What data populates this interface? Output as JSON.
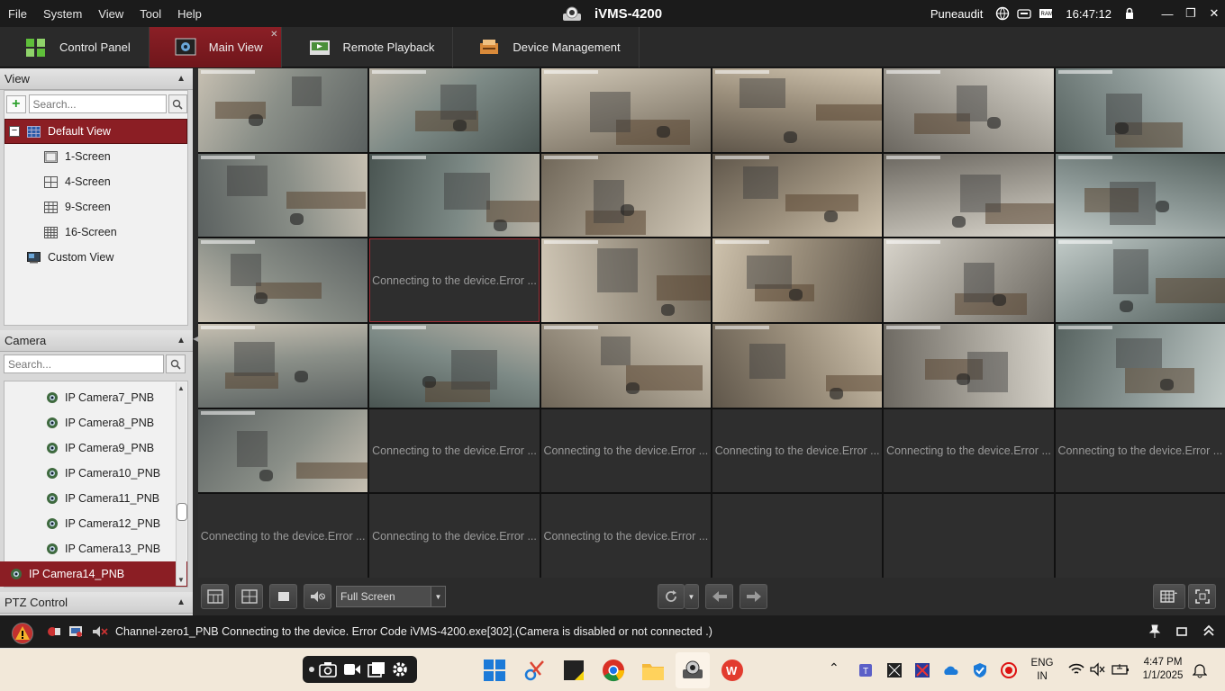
{
  "menubar": {
    "menus": [
      "File",
      "System",
      "View",
      "Tool",
      "Help"
    ],
    "app_title": "iVMS-4200",
    "user": "Puneaudit",
    "clock": "16:47:12"
  },
  "tabs": [
    {
      "label": "Control Panel"
    },
    {
      "label": "Main View"
    },
    {
      "label": "Remote Playback"
    },
    {
      "label": "Device Management"
    }
  ],
  "view_panel": {
    "title": "View",
    "search_placeholder": "Search...",
    "default_view": "Default View",
    "items": [
      "1-Screen",
      "4-Screen",
      "9-Screen",
      "16-Screen"
    ],
    "custom_view": "Custom View"
  },
  "camera_panel": {
    "title": "Camera",
    "search_placeholder": "Search...",
    "cameras": [
      "IP Camera7_PNB",
      "IP Camera8_PNB",
      "IP Camera9_PNB",
      "IP Camera10_PNB",
      "IP Camera11_PNB",
      "IP Camera12_PNB",
      "IP Camera13_PNB",
      "IP Camera14_PNB"
    ],
    "selected": "IP Camera14_PNB"
  },
  "ptz_panel": {
    "title": "PTZ Control"
  },
  "grid": {
    "error_message": "Connecting to the device.Error ..."
  },
  "toolbar": {
    "screen_mode": "Full Screen"
  },
  "status": {
    "message": "Channel-zero1_PNB Connecting to the device. Error Code iVMS-4200.exe[302].(Camera is disabled or not connected .)"
  },
  "taskbar": {
    "lang_line1": "ENG",
    "lang_line2": "IN",
    "time": "4:47 PM",
    "date": "1/1/2025"
  },
  "colors": {
    "accent": "#8b1e24",
    "grid_bg": "#2e2e2e"
  }
}
